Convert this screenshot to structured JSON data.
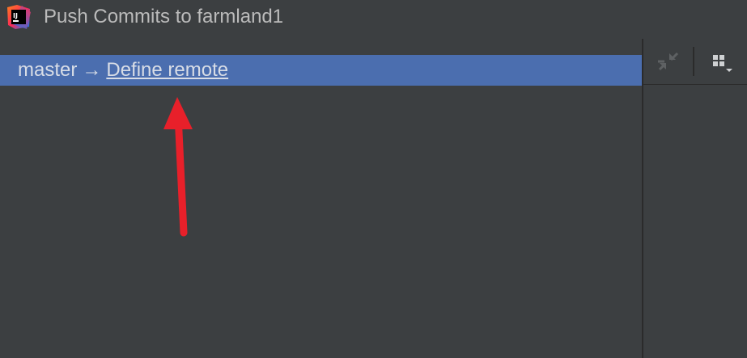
{
  "window": {
    "title": "Push Commits to farmland1",
    "app_icon": "intellij-idea-icon"
  },
  "branch_row": {
    "local_branch": "master",
    "arrow": "→",
    "remote_link": "Define remote"
  },
  "toolbar": {
    "collapse_icon": "collapse-arrows-icon",
    "group_icon": "grid-options-icon"
  },
  "annotation": {
    "arrow_color": "#e8202a",
    "icon": "red-arrow-annotation-icon"
  },
  "colors": {
    "background": "#3c3f41",
    "selection": "#4b6eaf",
    "text": "#bbbbbb"
  }
}
